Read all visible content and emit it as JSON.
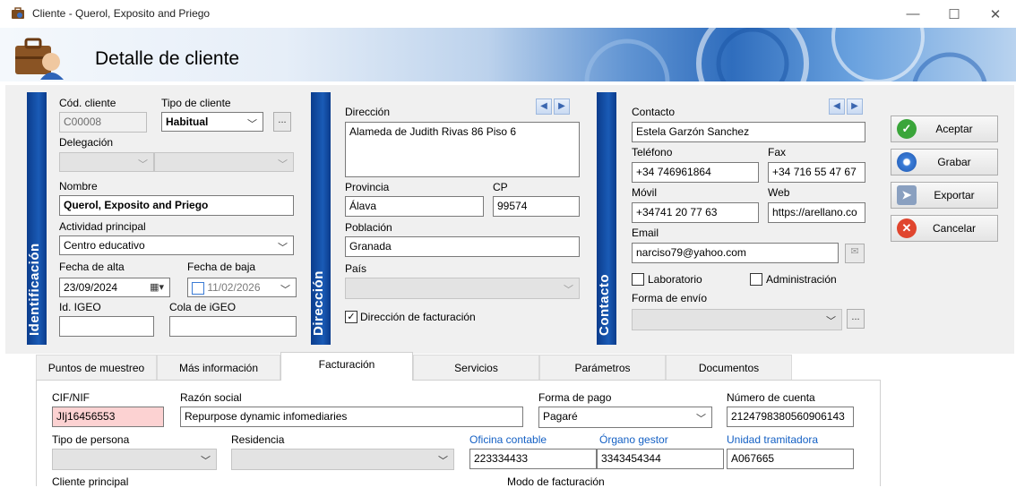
{
  "window": {
    "title": "Cliente - Querol, Exposito and Priego",
    "minimize": "—",
    "maximize": "☐",
    "close": "✕"
  },
  "header": {
    "title": "Detalle de cliente"
  },
  "sections": {
    "identificacion": "Identificación",
    "direccion": "Dirección",
    "contacto": "Contacto"
  },
  "ident": {
    "cod_label": "Cód. cliente",
    "cod_value": "C00008",
    "tipo_label": "Tipo de cliente",
    "tipo_value": "Habitual",
    "delegacion_label": "Delegación",
    "nombre_label": "Nombre",
    "nombre_value": "Querol, Exposito and Priego",
    "actividad_label": "Actividad principal",
    "actividad_value": "Centro educativo",
    "alta_label": "Fecha de alta",
    "alta_value": "23/09/2024",
    "baja_label": "Fecha de baja",
    "baja_value": "11/02/2026",
    "igeo_label": "Id. IGEO",
    "cola_label": "Cola de iGEO",
    "more": "..."
  },
  "direccion": {
    "dir_label": "Dirección",
    "dir_value": "Alameda de Judith Rivas 86 Piso 6",
    "provincia_label": "Provincia",
    "provincia_value": "Álava",
    "cp_label": "CP",
    "cp_value": "99574",
    "poblacion_label": "Población",
    "poblacion_value": "Granada",
    "pais_label": "País",
    "facturacion_label": "Dirección de facturación"
  },
  "contacto": {
    "contacto_label": "Contacto",
    "contacto_value": "Estela Garzón Sanchez",
    "telefono_label": "Teléfono",
    "telefono_value": "+34 746961864",
    "fax_label": "Fax",
    "fax_value": "+34 716 55 47 67",
    "movil_label": "Móvil",
    "movil_value": "+34741 20 77 63",
    "web_label": "Web",
    "web_value": "https://arellano.co",
    "email_label": "Email",
    "email_value": "narciso79@yahoo.com",
    "laboratorio_label": "Laboratorio",
    "administracion_label": "Administración",
    "envio_label": "Forma de envío",
    "more": "..."
  },
  "actions": {
    "aceptar": "Aceptar",
    "grabar": "Grabar",
    "exportar": "Exportar",
    "cancelar": "Cancelar"
  },
  "tabs": [
    "Puntos de muestreo",
    "Más información",
    "Facturación",
    "Servicios",
    "Parámetros",
    "Documentos"
  ],
  "facturacion": {
    "cif_label": "CIF/NIF",
    "cif_value": "JIj16456553",
    "razon_label": "Razón social",
    "razon_value": "Repurpose dynamic infomediaries",
    "pago_label": "Forma de pago",
    "pago_value": "Pagaré",
    "cuenta_label": "Número de cuenta",
    "cuenta_value": "2124798380560906143",
    "persona_label": "Tipo de persona",
    "residencia_label": "Residencia",
    "oficina_label": "Oficina contable",
    "oficina_value": "223334433",
    "organo_label": "Órgano gestor",
    "organo_value": "3343454344",
    "unidad_label": "Unidad tramitadora",
    "unidad_value": "A067665",
    "principal_label": "Cliente principal",
    "modo_label": "Modo de facturación"
  },
  "colors": {
    "accent": "#1460c4",
    "sidebar": "#1a5bb6",
    "error_field": "#fcd2d2"
  }
}
